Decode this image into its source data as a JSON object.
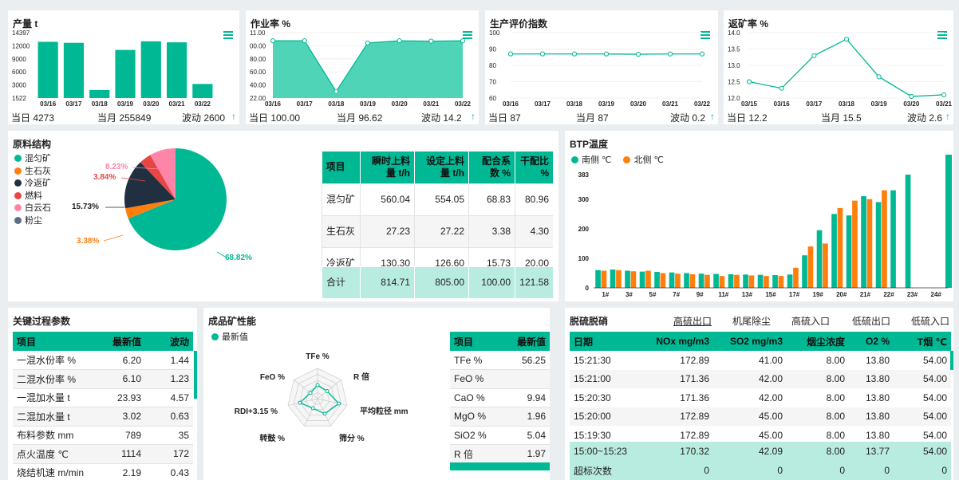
{
  "colors": {
    "accent": "#00b894",
    "orange": "#ff7f0e",
    "dark": "#203040",
    "red": "#e84545",
    "pink": "#ff85a8",
    "slate": "#5d6d85",
    "light_teal": "#b9ece0"
  },
  "p1": {
    "title": "产量 t",
    "y_ticks": [
      "14397",
      "12000",
      "9000",
      "6000",
      "3000",
      "1522"
    ],
    "foot": {
      "day": "当日 4273",
      "month": "当月 255849",
      "wave": "波动 2600",
      "arrow": "↑"
    }
  },
  "p2": {
    "title": "作业率 %",
    "y_ticks": [
      "11.00",
      "00.00",
      "80.00",
      "60.00",
      "40.00",
      "22.00"
    ],
    "foot": {
      "day": "当日 100.00",
      "month": "当月 96.62",
      "wave": "波动 14.2",
      "arrow": "↑"
    }
  },
  "p3": {
    "title": "生产评价指数",
    "y_ticks": [
      "100",
      "90",
      "80",
      "70",
      "60"
    ],
    "foot": {
      "day": "当日 87",
      "month": "当月 87",
      "wave": "波动 0.2",
      "arrow": "↑"
    }
  },
  "p4": {
    "title": "返矿率 %",
    "y_ticks": [
      "14.0",
      "13.5",
      "13.0",
      "12.5",
      "12.0"
    ],
    "foot": {
      "day": "当日 12.2",
      "month": "当月 15.5",
      "wave": "波动 2.6",
      "arrow": "↑"
    }
  },
  "raw": {
    "title": "原料结构",
    "legend": [
      {
        "name": "混匀矿",
        "color": "#00b894"
      },
      {
        "name": "生石灰",
        "color": "#ff7f0e"
      },
      {
        "name": "冷返矿",
        "color": "#203040"
      },
      {
        "name": "燃料",
        "color": "#e84545"
      },
      {
        "name": "白云石",
        "color": "#ff85a8"
      },
      {
        "name": "粉尘",
        "color": "#5d6d85"
      }
    ],
    "labels": {
      "a": "68.82%",
      "b": "3.38%",
      "c": "15.73%",
      "d": "3.84%",
      "e": "8.23%"
    },
    "table": {
      "headers": [
        "项目",
        "瞬时上料量 t/h",
        "设定上料量 t/h",
        "配合系数 %",
        "干配比 %"
      ],
      "rows": [
        [
          "混匀矿",
          "560.04",
          "554.05",
          "68.83",
          "80.96"
        ],
        [
          "生石灰",
          "27.23",
          "27.22",
          "3.38",
          "4.30"
        ],
        [
          "冷返矿",
          "130.30",
          "126.60",
          "15.73",
          "20.00"
        ]
      ],
      "total": [
        "合计",
        "814.71",
        "805.00",
        "100.00",
        "121.58"
      ]
    }
  },
  "btp": {
    "title": "BTP温度",
    "legend": [
      "南侧 ℃",
      "北侧 ℃"
    ],
    "y_ticks": [
      "383",
      "300",
      "200",
      "100",
      "0"
    ]
  },
  "key": {
    "title": "关键过程参数",
    "headers": [
      "项目",
      "最新值",
      "波动"
    ],
    "rows": [
      [
        "一混水份率 %",
        "6.20",
        "1.44"
      ],
      [
        "二混水份率 %",
        "6.10",
        "1.23"
      ],
      [
        "一混加水量 t",
        "23.93",
        "4.57"
      ],
      [
        "二混加水量 t",
        "3.02",
        "0.63"
      ],
      [
        "布料参数 mm",
        "789",
        "35"
      ],
      [
        "点火温度 ℃",
        "1114",
        "172"
      ],
      [
        "烧结机速 m/min",
        "2.19",
        "0.43"
      ]
    ]
  },
  "product": {
    "title": "成品矿性能",
    "legend": "最新值",
    "radar_labels": [
      "TFe %",
      "R 倍",
      "平均粒径 mm",
      "筛分 %",
      "转鼓 %",
      "RDI+3.15 %",
      "FeO %"
    ],
    "radar_values": [
      0.45,
      0.4,
      0.72,
      0.55,
      0.35,
      0.6,
      0.3
    ],
    "headers": [
      "项目",
      "最新值"
    ],
    "rows": [
      [
        "TFe %",
        "56.25"
      ],
      [
        "FeO %",
        ""
      ],
      [
        "CaO %",
        "9.94"
      ],
      [
        "MgO %",
        "1.96"
      ],
      [
        "SiO2 %",
        "5.04"
      ],
      [
        "R 倍",
        "1.97"
      ]
    ]
  },
  "desulf": {
    "title": "脱硫脱硝",
    "tabs": [
      "高硫出口",
      "机尾除尘",
      "高硫入口",
      "低硫出口",
      "低硫入口"
    ],
    "headers": [
      "日期",
      "NOx mg/m3",
      "SO2 mg/m3",
      "烟尘浓度",
      "O2 %",
      "T烟 ℃"
    ],
    "rows": [
      [
        "15:21:30",
        "172.89",
        "41.00",
        "8.00",
        "13.80",
        "54.00"
      ],
      [
        "15:21:00",
        "171.36",
        "42.00",
        "8.00",
        "13.80",
        "54.00"
      ],
      [
        "15:20:30",
        "171.36",
        "42.00",
        "8.00",
        "13.80",
        "54.00"
      ],
      [
        "15:20:00",
        "172.89",
        "45.00",
        "8.00",
        "13.80",
        "54.00"
      ],
      [
        "15:19:30",
        "172.89",
        "45.00",
        "8.00",
        "13.80",
        "54.00"
      ]
    ],
    "summary": [
      "15:00~15:23",
      "170.32",
      "42.09",
      "8.00",
      "13.77",
      "54.00"
    ],
    "exceed": [
      "超标次数",
      "0",
      "0",
      "0",
      "0",
      "0"
    ]
  },
  "chart_data": [
    {
      "type": "bar",
      "title": "产量 t",
      "categories": [
        "03/16",
        "03/17",
        "03/18",
        "03/19",
        "03/20",
        "03/21",
        "03/22"
      ],
      "values": [
        12600,
        12400,
        3100,
        11000,
        12700,
        12500,
        4300
      ],
      "ylim": [
        1522,
        14397
      ]
    },
    {
      "type": "area",
      "title": "作业率 %",
      "categories": [
        "03/16",
        "03/17",
        "03/18",
        "03/19",
        "03/20",
        "03/21",
        "03/22"
      ],
      "values": [
        100,
        100,
        31,
        97,
        100,
        99.5,
        100
      ],
      "ylim": [
        22,
        111
      ]
    },
    {
      "type": "line",
      "title": "生产评价指数",
      "categories": [
        "03/16",
        "03/17",
        "03/18",
        "03/19",
        "03/20",
        "03/21",
        "03/22"
      ],
      "values": [
        87,
        87,
        87,
        87,
        86.8,
        87,
        87
      ],
      "ylim": [
        60,
        100
      ]
    },
    {
      "type": "line",
      "title": "返矿率 %",
      "categories": [
        "03/15",
        "03/16",
        "03/17",
        "03/18",
        "03/19",
        "03/20",
        "03/21"
      ],
      "values": [
        12.5,
        12.3,
        13.3,
        13.8,
        12.65,
        12.05,
        12.1
      ],
      "ylim": [
        12,
        14
      ]
    },
    {
      "type": "pie",
      "title": "原料结构",
      "labels": [
        "混匀矿",
        "生石灰",
        "冷返矿",
        "燃料",
        "白云石",
        "粉尘"
      ],
      "values": [
        68.82,
        3.38,
        15.73,
        3.84,
        8.23,
        0
      ]
    },
    {
      "type": "bar",
      "title": "BTP温度",
      "categories": [
        "1#",
        "2#",
        "3#",
        "4#",
        "5#",
        "6#",
        "7#",
        "8#",
        "9#",
        "10#",
        "11#",
        "12#",
        "13#",
        "14#",
        "15#",
        "16#",
        "17#",
        "18#",
        "19#",
        "20#",
        "21#",
        "22#",
        "23#",
        "24#"
      ],
      "x_tick_labels": [
        "1#",
        "3#",
        "5#",
        "7#",
        "9#",
        "11#",
        "13#",
        "15#",
        "17#",
        "19#",
        "20#",
        "21#",
        "22#",
        "23#",
        "24#"
      ],
      "series": [
        {
          "name": "南侧 ℃",
          "values": [
            60,
            62,
            58,
            55,
            54,
            52,
            50,
            48,
            47,
            46,
            45,
            44,
            43,
            45,
            110,
            195,
            250,
            245,
            310,
            290,
            330,
            383,
            0,
            0
          ]
        },
        {
          "name": "北侧 ℃",
          "values": [
            58,
            60,
            56,
            58,
            50,
            48,
            46,
            44,
            40,
            44,
            42,
            40,
            40,
            68,
            140,
            150,
            270,
            295,
            300,
            330,
            0,
            0,
            0,
            0
          ]
        }
      ],
      "ylim": [
        0,
        383
      ]
    }
  ]
}
